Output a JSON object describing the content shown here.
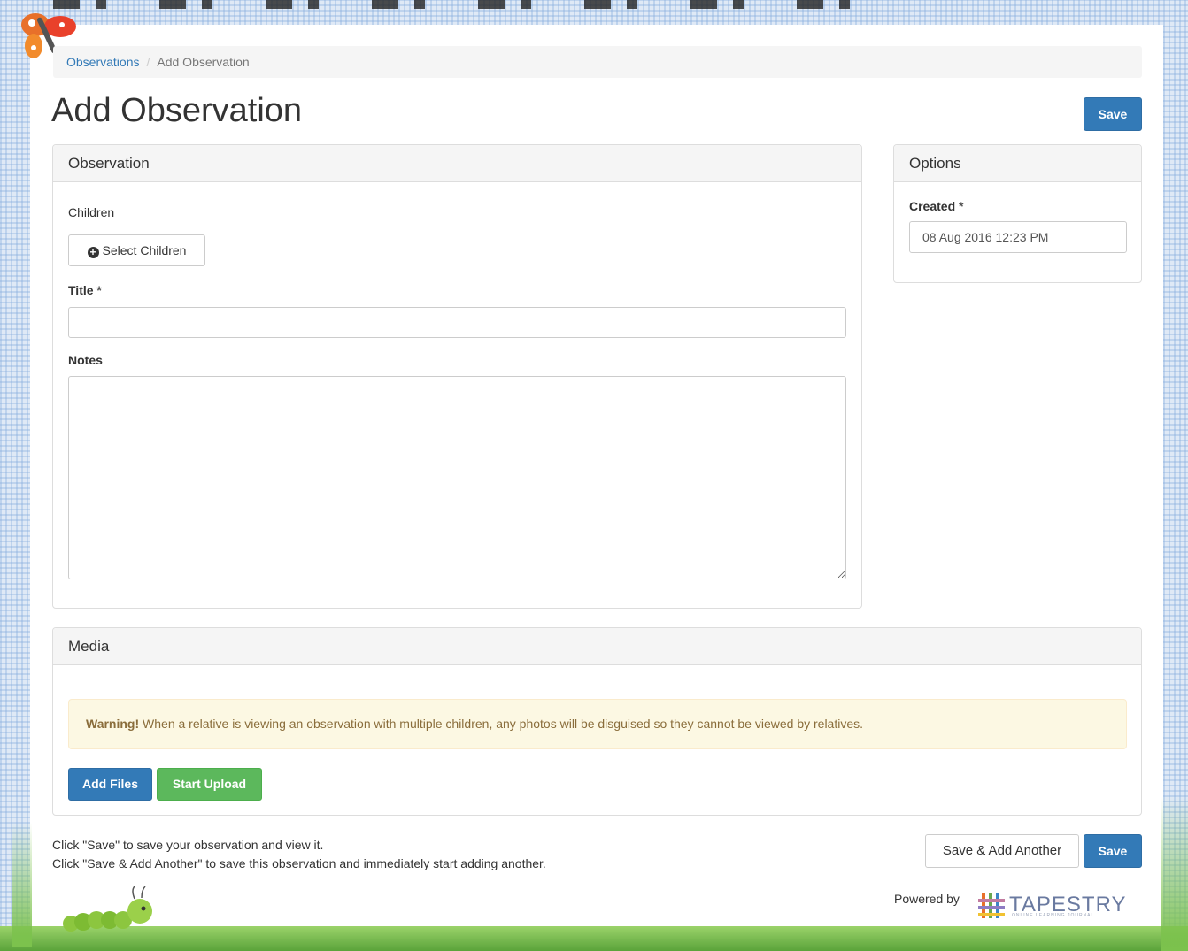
{
  "breadcrumb": {
    "link": "Observations",
    "separator": "/",
    "current": "Add Observation"
  },
  "page_title": "Add Observation",
  "buttons": {
    "save": "Save",
    "select_children": "Select Children",
    "add_files": "Add Files",
    "start_upload": "Start Upload",
    "save_add_another": "Save & Add Another"
  },
  "observation_panel": {
    "heading": "Observation",
    "children_label": "Children",
    "title_label": "Title",
    "title_value": "",
    "notes_label": "Notes",
    "notes_value": "",
    "required_marker": "*"
  },
  "options_panel": {
    "heading": "Options",
    "created_label": "Created",
    "created_value": "08 Aug 2016 12:23 PM"
  },
  "media_panel": {
    "heading": "Media",
    "warning_strong": "Warning!",
    "warning_text": " When a relative is viewing an observation with multiple children, any photos will be disguised so they cannot be viewed by relatives."
  },
  "help_text": {
    "line1": "Click \"Save\" to save your observation and view it.",
    "line2": "Click \"Save & Add Another\" to save this observation and immediately start adding another."
  },
  "footer": {
    "powered_by": "Powered by",
    "brand": "TAPESTRY",
    "brand_sub": "ONLINE LEARNING JOURNAL"
  },
  "icons": {
    "select_children": "plus-circle-icon"
  },
  "colors": {
    "primary": "#337ab7",
    "success": "#5cb85c",
    "warning_bg": "#fcf8e3",
    "warning_text": "#8a6d3b",
    "link": "#337ab7"
  }
}
